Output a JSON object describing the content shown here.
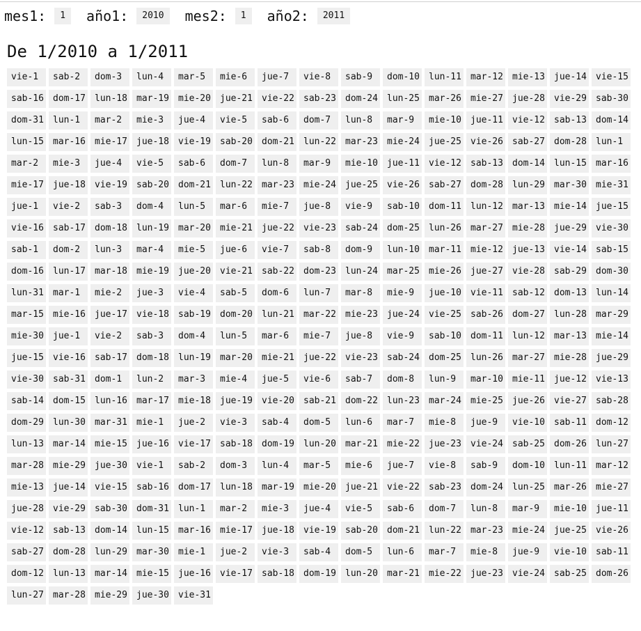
{
  "form": {
    "mes1_label": "mes1:",
    "mes1_value": "1",
    "anio1_label": "año1:",
    "anio1_value": "2010",
    "mes2_label": "mes2:",
    "mes2_value": "1",
    "anio2_label": "año2:",
    "anio2_value": "2011"
  },
  "heading": "De 1/2010 a 1/2011",
  "days": [
    "vie-1",
    "sab-2",
    "dom-3",
    "lun-4",
    "mar-5",
    "mie-6",
    "jue-7",
    "vie-8",
    "sab-9",
    "dom-10",
    "lun-11",
    "mar-12",
    "mie-13",
    "jue-14",
    "vie-15",
    "sab-16",
    "dom-17",
    "lun-18",
    "mar-19",
    "mie-20",
    "jue-21",
    "vie-22",
    "sab-23",
    "dom-24",
    "lun-25",
    "mar-26",
    "mie-27",
    "jue-28",
    "vie-29",
    "sab-30",
    "dom-31",
    "lun-1",
    "mar-2",
    "mie-3",
    "jue-4",
    "vie-5",
    "sab-6",
    "dom-7",
    "lun-8",
    "mar-9",
    "mie-10",
    "jue-11",
    "vie-12",
    "sab-13",
    "dom-14",
    "lun-15",
    "mar-16",
    "mie-17",
    "jue-18",
    "vie-19",
    "sab-20",
    "dom-21",
    "lun-22",
    "mar-23",
    "mie-24",
    "jue-25",
    "vie-26",
    "sab-27",
    "dom-28",
    "lun-1",
    "mar-2",
    "mie-3",
    "jue-4",
    "vie-5",
    "sab-6",
    "dom-7",
    "lun-8",
    "mar-9",
    "mie-10",
    "jue-11",
    "vie-12",
    "sab-13",
    "dom-14",
    "lun-15",
    "mar-16",
    "mie-17",
    "jue-18",
    "vie-19",
    "sab-20",
    "dom-21",
    "lun-22",
    "mar-23",
    "mie-24",
    "jue-25",
    "vie-26",
    "sab-27",
    "dom-28",
    "lun-29",
    "mar-30",
    "mie-31",
    "jue-1",
    "vie-2",
    "sab-3",
    "dom-4",
    "lun-5",
    "mar-6",
    "mie-7",
    "jue-8",
    "vie-9",
    "sab-10",
    "dom-11",
    "lun-12",
    "mar-13",
    "mie-14",
    "jue-15",
    "vie-16",
    "sab-17",
    "dom-18",
    "lun-19",
    "mar-20",
    "mie-21",
    "jue-22",
    "vie-23",
    "sab-24",
    "dom-25",
    "lun-26",
    "mar-27",
    "mie-28",
    "jue-29",
    "vie-30",
    "sab-1",
    "dom-2",
    "lun-3",
    "mar-4",
    "mie-5",
    "jue-6",
    "vie-7",
    "sab-8",
    "dom-9",
    "lun-10",
    "mar-11",
    "mie-12",
    "jue-13",
    "vie-14",
    "sab-15",
    "dom-16",
    "lun-17",
    "mar-18",
    "mie-19",
    "jue-20",
    "vie-21",
    "sab-22",
    "dom-23",
    "lun-24",
    "mar-25",
    "mie-26",
    "jue-27",
    "vie-28",
    "sab-29",
    "dom-30",
    "lun-31",
    "mar-1",
    "mie-2",
    "jue-3",
    "vie-4",
    "sab-5",
    "dom-6",
    "lun-7",
    "mar-8",
    "mie-9",
    "jue-10",
    "vie-11",
    "sab-12",
    "dom-13",
    "lun-14",
    "mar-15",
    "mie-16",
    "jue-17",
    "vie-18",
    "sab-19",
    "dom-20",
    "lun-21",
    "mar-22",
    "mie-23",
    "jue-24",
    "vie-25",
    "sab-26",
    "dom-27",
    "lun-28",
    "mar-29",
    "mie-30",
    "jue-1",
    "vie-2",
    "sab-3",
    "dom-4",
    "lun-5",
    "mar-6",
    "mie-7",
    "jue-8",
    "vie-9",
    "sab-10",
    "dom-11",
    "lun-12",
    "mar-13",
    "mie-14",
    "jue-15",
    "vie-16",
    "sab-17",
    "dom-18",
    "lun-19",
    "mar-20",
    "mie-21",
    "jue-22",
    "vie-23",
    "sab-24",
    "dom-25",
    "lun-26",
    "mar-27",
    "mie-28",
    "jue-29",
    "vie-30",
    "sab-31",
    "dom-1",
    "lun-2",
    "mar-3",
    "mie-4",
    "jue-5",
    "vie-6",
    "sab-7",
    "dom-8",
    "lun-9",
    "mar-10",
    "mie-11",
    "jue-12",
    "vie-13",
    "sab-14",
    "dom-15",
    "lun-16",
    "mar-17",
    "mie-18",
    "jue-19",
    "vie-20",
    "sab-21",
    "dom-22",
    "lun-23",
    "mar-24",
    "mie-25",
    "jue-26",
    "vie-27",
    "sab-28",
    "dom-29",
    "lun-30",
    "mar-31",
    "mie-1",
    "jue-2",
    "vie-3",
    "sab-4",
    "dom-5",
    "lun-6",
    "mar-7",
    "mie-8",
    "jue-9",
    "vie-10",
    "sab-11",
    "dom-12",
    "lun-13",
    "mar-14",
    "mie-15",
    "jue-16",
    "vie-17",
    "sab-18",
    "dom-19",
    "lun-20",
    "mar-21",
    "mie-22",
    "jue-23",
    "vie-24",
    "sab-25",
    "dom-26",
    "lun-27",
    "mar-28",
    "mie-29",
    "jue-30",
    "vie-1",
    "sab-2",
    "dom-3",
    "lun-4",
    "mar-5",
    "mie-6",
    "jue-7",
    "vie-8",
    "sab-9",
    "dom-10",
    "lun-11",
    "mar-12",
    "mie-13",
    "jue-14",
    "vie-15",
    "sab-16",
    "dom-17",
    "lun-18",
    "mar-19",
    "mie-20",
    "jue-21",
    "vie-22",
    "sab-23",
    "dom-24",
    "lun-25",
    "mar-26",
    "mie-27",
    "jue-28",
    "vie-29",
    "sab-30",
    "dom-31",
    "lun-1",
    "mar-2",
    "mie-3",
    "jue-4",
    "vie-5",
    "sab-6",
    "dom-7",
    "lun-8",
    "mar-9",
    "mie-10",
    "jue-11",
    "vie-12",
    "sab-13",
    "dom-14",
    "lun-15",
    "mar-16",
    "mie-17",
    "jue-18",
    "vie-19",
    "sab-20",
    "dom-21",
    "lun-22",
    "mar-23",
    "mie-24",
    "jue-25",
    "vie-26",
    "sab-27",
    "dom-28",
    "lun-29",
    "mar-30",
    "mie-1",
    "jue-2",
    "vie-3",
    "sab-4",
    "dom-5",
    "lun-6",
    "mar-7",
    "mie-8",
    "jue-9",
    "vie-10",
    "sab-11",
    "dom-12",
    "lun-13",
    "mar-14",
    "mie-15",
    "jue-16",
    "vie-17",
    "sab-18",
    "dom-19",
    "lun-20",
    "mar-21",
    "mie-22",
    "jue-23",
    "vie-24",
    "sab-25",
    "dom-26",
    "lun-27",
    "mar-28",
    "mie-29",
    "jue-30",
    "vie-31"
  ]
}
